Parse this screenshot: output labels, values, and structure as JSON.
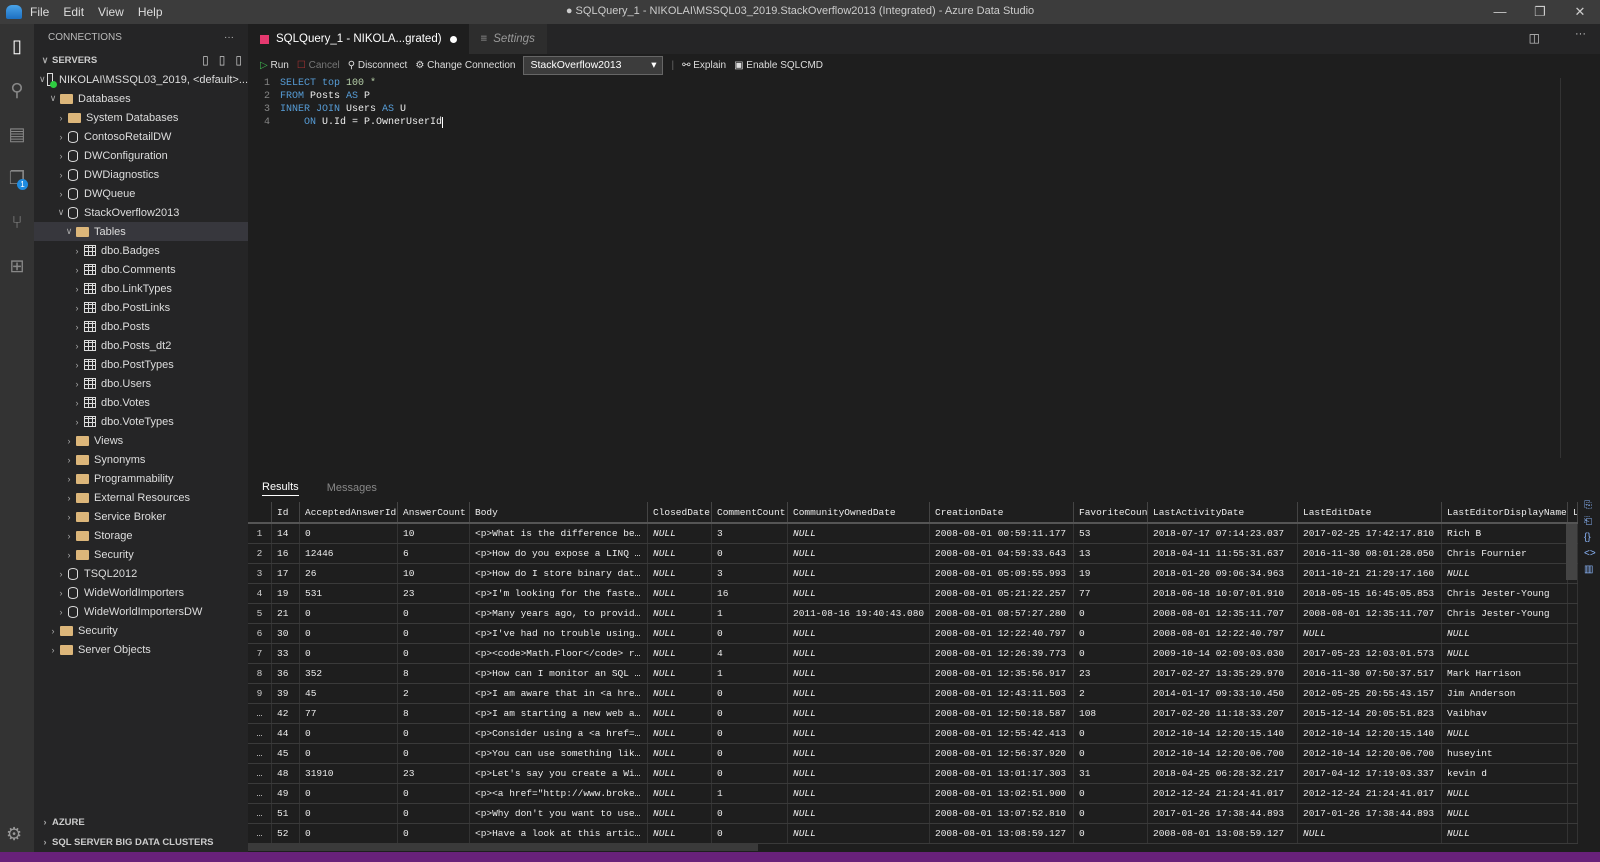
{
  "window": {
    "title": "● SQLQuery_1 - NIKOLAI\\MSSQL03_2019.StackOverflow2013 (Integrated) - Azure Data Studio",
    "menu": [
      "File",
      "Edit",
      "View",
      "Help"
    ]
  },
  "activity": {
    "badge": "1"
  },
  "sidebar": {
    "header": "CONNECTIONS",
    "more": "···",
    "servers_label": "SERVERS",
    "tree": [
      {
        "label": "NIKOLAI\\MSSQL03_2019, <default>...",
        "indent": 0,
        "icon": "server",
        "open": true
      },
      {
        "label": "Databases",
        "indent": 1,
        "icon": "folder",
        "open": true
      },
      {
        "label": "System Databases",
        "indent": 2,
        "icon": "folder"
      },
      {
        "label": "ContosoRetailDW",
        "indent": 2,
        "icon": "db"
      },
      {
        "label": "DWConfiguration",
        "indent": 2,
        "icon": "db"
      },
      {
        "label": "DWDiagnostics",
        "indent": 2,
        "icon": "db"
      },
      {
        "label": "DWQueue",
        "indent": 2,
        "icon": "db"
      },
      {
        "label": "StackOverflow2013",
        "indent": 2,
        "icon": "db",
        "open": true
      },
      {
        "label": "Tables",
        "indent": 3,
        "icon": "folder",
        "open": true,
        "selected": true
      },
      {
        "label": "dbo.Badges",
        "indent": 4,
        "icon": "table"
      },
      {
        "label": "dbo.Comments",
        "indent": 4,
        "icon": "table"
      },
      {
        "label": "dbo.LinkTypes",
        "indent": 4,
        "icon": "table"
      },
      {
        "label": "dbo.PostLinks",
        "indent": 4,
        "icon": "table"
      },
      {
        "label": "dbo.Posts",
        "indent": 4,
        "icon": "table"
      },
      {
        "label": "dbo.Posts_dt2",
        "indent": 4,
        "icon": "table"
      },
      {
        "label": "dbo.PostTypes",
        "indent": 4,
        "icon": "table"
      },
      {
        "label": "dbo.Users",
        "indent": 4,
        "icon": "table"
      },
      {
        "label": "dbo.Votes",
        "indent": 4,
        "icon": "table"
      },
      {
        "label": "dbo.VoteTypes",
        "indent": 4,
        "icon": "table"
      },
      {
        "label": "Views",
        "indent": 3,
        "icon": "folder"
      },
      {
        "label": "Synonyms",
        "indent": 3,
        "icon": "folder"
      },
      {
        "label": "Programmability",
        "indent": 3,
        "icon": "folder"
      },
      {
        "label": "External Resources",
        "indent": 3,
        "icon": "folder"
      },
      {
        "label": "Service Broker",
        "indent": 3,
        "icon": "folder"
      },
      {
        "label": "Storage",
        "indent": 3,
        "icon": "folder"
      },
      {
        "label": "Security",
        "indent": 3,
        "icon": "folder"
      },
      {
        "label": "TSQL2012",
        "indent": 2,
        "icon": "db"
      },
      {
        "label": "WideWorldImporters",
        "indent": 2,
        "icon": "db"
      },
      {
        "label": "WideWorldImportersDW",
        "indent": 2,
        "icon": "db"
      },
      {
        "label": "Security",
        "indent": 1,
        "icon": "folder"
      },
      {
        "label": "Server Objects",
        "indent": 1,
        "icon": "folder"
      }
    ],
    "bottom": [
      "AZURE",
      "SQL SERVER BIG DATA CLUSTERS"
    ]
  },
  "tabs": [
    {
      "label": "SQLQuery_1 - NIKOLA...grated)",
      "active": true
    },
    {
      "label": "Settings",
      "active": false
    }
  ],
  "toolbar": {
    "run": "Run",
    "cancel": "Cancel",
    "disconnect": "Disconnect",
    "change": "Change Connection",
    "database": "StackOverflow2013",
    "explain": "Explain",
    "sqlcmd": "Enable SQLCMD"
  },
  "code": [
    [
      {
        "t": "SELECT top ",
        "k": "kw"
      },
      {
        "t": "100 *",
        "k": "num"
      }
    ],
    [
      {
        "t": "FROM ",
        "k": "kw"
      },
      {
        "t": "Posts ",
        "k": "id"
      },
      {
        "t": "AS ",
        "k": "kw"
      },
      {
        "t": "P",
        "k": "id"
      }
    ],
    [
      {
        "t": "INNER JOIN ",
        "k": "kw"
      },
      {
        "t": "Users ",
        "k": "id"
      },
      {
        "t": "AS ",
        "k": "kw"
      },
      {
        "t": "U",
        "k": "id"
      }
    ],
    [
      {
        "t": "    ON ",
        "k": "kw"
      },
      {
        "t": "U.Id = P.OwnerUserId",
        "k": "id"
      }
    ]
  ],
  "results": {
    "tabs": [
      "Results",
      "Messages"
    ],
    "columns": [
      "",
      "Id",
      "AcceptedAnswerId",
      "AnswerCount",
      "Body",
      "ClosedDate",
      "CommentCount",
      "CommunityOwnedDate",
      "CreationDate",
      "FavoriteCount",
      "LastActivityDate",
      "LastEditDate",
      "LastEditorDisplayName",
      "L"
    ],
    "rows": [
      [
        "1",
        "14",
        "0",
        "10",
        "<p>What is the difference be…",
        "NULL",
        "3",
        "NULL",
        "2008-08-01 00:59:11.177",
        "53",
        "2018-07-17 07:14:23.037",
        "2017-02-25 17:42:17.810",
        "Rich B",
        ""
      ],
      [
        "2",
        "16",
        "12446",
        "6",
        "<p>How do you expose a LINQ …",
        "NULL",
        "0",
        "NULL",
        "2008-08-01 04:59:33.643",
        "13",
        "2018-04-11 11:55:31.637",
        "2016-11-30 08:01:28.050",
        "Chris Fournier",
        ""
      ],
      [
        "3",
        "17",
        "26",
        "10",
        "<p>How do I store binary dat…",
        "NULL",
        "3",
        "NULL",
        "2008-08-01 05:09:55.993",
        "19",
        "2018-01-20 09:06:34.963",
        "2011-10-21 21:29:17.160",
        "NULL",
        ""
      ],
      [
        "4",
        "19",
        "531",
        "23",
        "<p>I'm looking for the faste…",
        "NULL",
        "16",
        "NULL",
        "2008-08-01 05:21:22.257",
        "77",
        "2018-06-18 10:07:01.910",
        "2018-05-15 16:45:05.853",
        "Chris Jester-Young",
        ""
      ],
      [
        "5",
        "21",
        "0",
        "0",
        "<p>Many years ago, to provid…",
        "NULL",
        "1",
        "2011-08-16 19:40:43.080",
        "2008-08-01 08:57:27.280",
        "0",
        "2008-08-01 12:35:11.707",
        "2008-08-01 12:35:11.707",
        "Chris Jester-Young",
        ""
      ],
      [
        "6",
        "30",
        "0",
        "0",
        "<p>I've had no trouble using…",
        "NULL",
        "0",
        "NULL",
        "2008-08-01 12:22:40.797",
        "0",
        "2008-08-01 12:22:40.797",
        "NULL",
        "NULL",
        ""
      ],
      [
        "7",
        "33",
        "0",
        "0",
        "<p><code>Math.Floor</code> r…",
        "NULL",
        "4",
        "NULL",
        "2008-08-01 12:26:39.773",
        "0",
        "2009-10-14 02:09:03.030",
        "2017-05-23 12:03:01.573",
        "NULL",
        ""
      ],
      [
        "8",
        "36",
        "352",
        "8",
        "<p>How can I monitor an SQL …",
        "NULL",
        "1",
        "NULL",
        "2008-08-01 12:35:56.917",
        "23",
        "2017-02-27 13:35:29.970",
        "2016-11-30 07:50:37.517",
        "Mark Harrison",
        ""
      ],
      [
        "9",
        "39",
        "45",
        "2",
        "<p>I am aware that in <a hre…",
        "NULL",
        "0",
        "NULL",
        "2008-08-01 12:43:11.503",
        "2",
        "2014-01-17 09:33:10.450",
        "2012-05-25 20:55:43.157",
        "Jim Anderson",
        ""
      ],
      [
        "…",
        "42",
        "77",
        "8",
        "<p>I am starting a new web a…",
        "NULL",
        "0",
        "NULL",
        "2008-08-01 12:50:18.587",
        "108",
        "2017-02-20 11:18:33.207",
        "2015-12-14 20:05:51.823",
        "Vaibhav",
        ""
      ],
      [
        "…",
        "44",
        "0",
        "0",
        "<p>Consider using a <a href=…",
        "NULL",
        "0",
        "NULL",
        "2008-08-01 12:55:42.413",
        "0",
        "2012-10-14 12:20:15.140",
        "2012-10-14 12:20:15.140",
        "NULL",
        ""
      ],
      [
        "…",
        "45",
        "0",
        "0",
        "<p>You can use something lik…",
        "NULL",
        "0",
        "NULL",
        "2008-08-01 12:56:37.920",
        "0",
        "2012-10-14 12:20:06.700",
        "2012-10-14 12:20:06.700",
        "huseyint",
        ""
      ],
      [
        "…",
        "48",
        "31910",
        "23",
        "<p>Let's say you create a Wi…",
        "NULL",
        "0",
        "NULL",
        "2008-08-01 13:01:17.303",
        "31",
        "2018-04-25 06:28:32.217",
        "2017-04-12 17:19:03.337",
        "kevin d",
        ""
      ],
      [
        "…",
        "49",
        "0",
        "0",
        "<p><a href=\"http://www.broke…",
        "NULL",
        "1",
        "NULL",
        "2008-08-01 13:02:51.900",
        "0",
        "2012-12-24 21:24:41.017",
        "2012-12-24 21:24:41.017",
        "NULL",
        ""
      ],
      [
        "…",
        "51",
        "0",
        "0",
        "<p>Why don't you want to use…",
        "NULL",
        "0",
        "NULL",
        "2008-08-01 13:07:52.810",
        "0",
        "2017-01-26 17:38:44.893",
        "2017-01-26 17:38:44.893",
        "NULL",
        ""
      ],
      [
        "…",
        "52",
        "0",
        "0",
        "<p>Have a look at this artic…",
        "NULL",
        "0",
        "NULL",
        "2008-08-01 13:08:59.127",
        "0",
        "2008-08-01 13:08:59.127",
        "NULL",
        "NULL",
        ""
      ]
    ]
  },
  "colors": {
    "accent": "#68217a",
    "query_icon": "#e5396f",
    "keyword": "#569cd6"
  }
}
